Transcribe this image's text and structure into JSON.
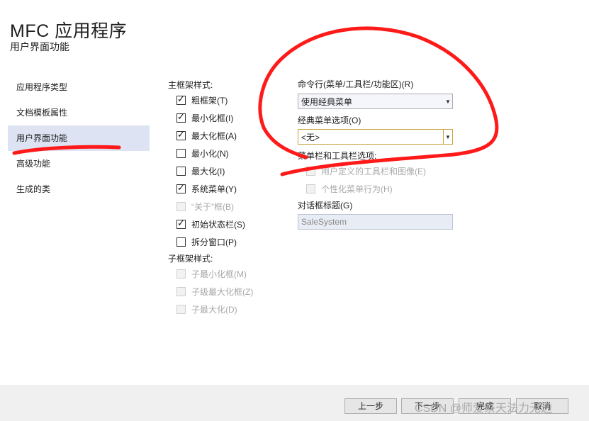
{
  "header": {
    "title": "MFC 应用程序",
    "subtitle": "用户界面功能"
  },
  "nav": {
    "items": [
      {
        "label": "应用程序类型"
      },
      {
        "label": "文档模板属性"
      },
      {
        "label": "用户界面功能"
      },
      {
        "label": "高级功能"
      },
      {
        "label": "生成的类"
      }
    ],
    "active_index": 2
  },
  "main_frame": {
    "label": "主框架样式:",
    "options": [
      {
        "label": "粗框架(T)",
        "checked": true,
        "enabled": true
      },
      {
        "label": "最小化框(I)",
        "checked": true,
        "enabled": true
      },
      {
        "label": "最大化框(A)",
        "checked": true,
        "enabled": true
      },
      {
        "label": "最小化(N)",
        "checked": false,
        "enabled": true
      },
      {
        "label": "最大化(I)",
        "checked": false,
        "enabled": true
      },
      {
        "label": "系统菜单(Y)",
        "checked": true,
        "enabled": true
      },
      {
        "label": "“关于”框(B)",
        "checked": false,
        "enabled": false
      },
      {
        "label": "初始状态栏(S)",
        "checked": true,
        "enabled": true
      },
      {
        "label": "拆分窗口(P)",
        "checked": false,
        "enabled": true
      }
    ]
  },
  "child_frame": {
    "label": "子框架样式:",
    "options": [
      {
        "label": "子最小化框(M)",
        "checked": false,
        "enabled": false
      },
      {
        "label": "子级最大化框(Z)",
        "checked": false,
        "enabled": false
      },
      {
        "label": "子最大化(D)",
        "checked": false,
        "enabled": false
      }
    ]
  },
  "command_bar": {
    "label": "命令行(菜单/工具栏/功能区)(R)",
    "value": "使用经典菜单"
  },
  "classic_menu": {
    "label": "经典菜单选项(O)",
    "value": "<无>"
  },
  "menu_toolbar": {
    "label": "菜单栏和工具栏选项:",
    "options": [
      {
        "label": "用户定义的工具栏和图像(E)",
        "checked": false,
        "enabled": false
      },
      {
        "label": "个性化菜单行为(H)",
        "checked": false,
        "enabled": false
      }
    ]
  },
  "dialog_title": {
    "label": "对话框标题(G)",
    "value": "SaleSystem"
  },
  "buttons": {
    "prev": "上一步",
    "next": "下一步",
    "finish": "完成",
    "cancel": "取消"
  },
  "watermark": "CSDN @师爱祭天法力无边",
  "colors": {
    "annotation": "#ff1a1a",
    "nav_active": "#dde3f2",
    "combo_highlight": "#c9a43a"
  }
}
